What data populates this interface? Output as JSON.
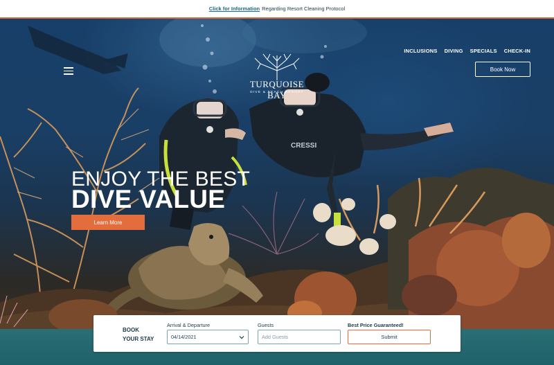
{
  "announcement": {
    "link_text": "Click for Information",
    "text": "Regarding Resort Cleaning Protocol"
  },
  "nav": {
    "items": [
      "INCLUSIONS",
      "DIVING",
      "SPECIALS",
      "CHECK-IN"
    ],
    "book_now": "Book Now"
  },
  "logo": {
    "name": "TURQUOISE BAY",
    "tagline": "DIVE & BEACH RESORT"
  },
  "hero": {
    "headline_line1": "ENJOY THE BEST",
    "headline_line2": "DIVE VALUE",
    "cta": "Learn More"
  },
  "booking": {
    "title_line1": "BOOK",
    "title_line2": "YOUR STAY",
    "dates_label": "Arrival & Departure",
    "dates_value": "04/14/2021",
    "guests_label": "Guests",
    "guests_placeholder": "Add Guests",
    "guarantee_label": "Best Price Guaranteed!",
    "submit": "Submit"
  },
  "colors": {
    "accent": "#e46d3d",
    "teal_band": "#2a6f75",
    "link": "#1a6b86",
    "text_dark": "#1a3a4c"
  },
  "icons": [
    "menu-icon",
    "chevron-down-icon",
    "coral-tree-logo-icon"
  ]
}
